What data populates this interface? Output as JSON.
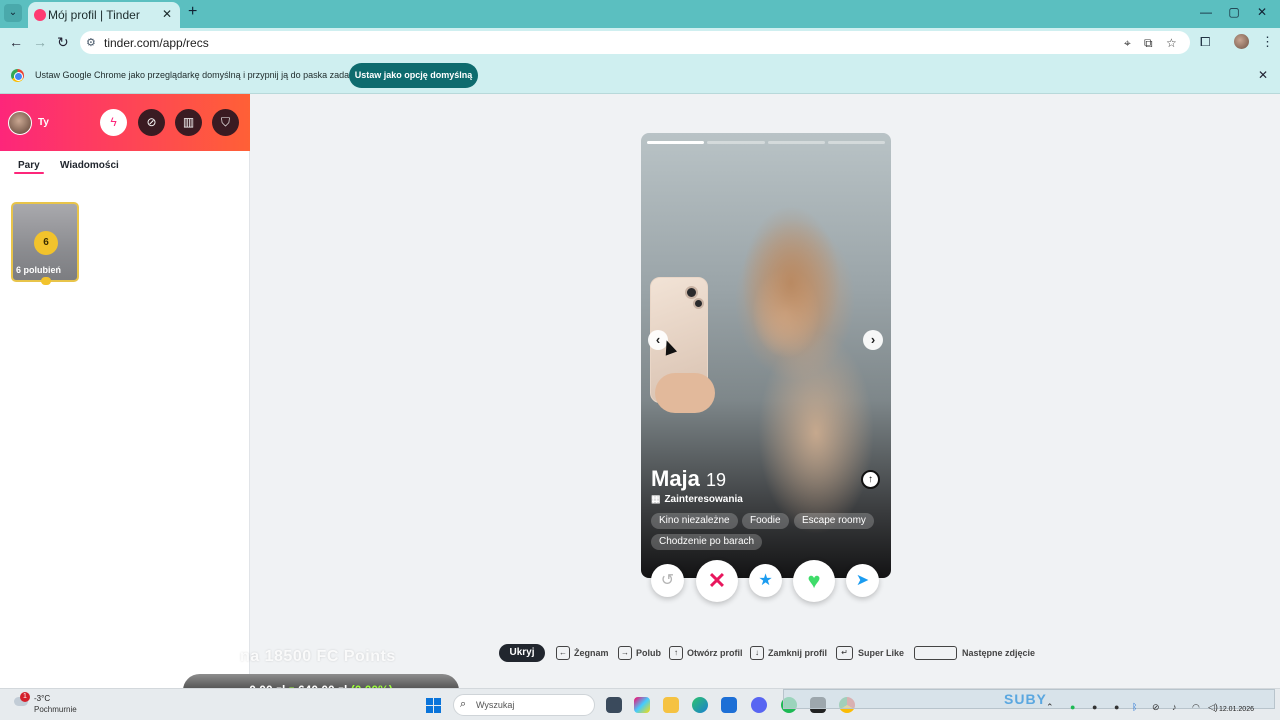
{
  "browser": {
    "tab_title": "Mój profil | Tinder",
    "url": "tinder.com/app/recs",
    "infobar_message": "Ustaw Google Chrome jako przeglądarkę domyślną i przypnij ją do paska zadań",
    "infobar_button": "Ustaw jako opcję domyślną"
  },
  "sidebar": {
    "user_label": "Ty",
    "tabs": [
      "Pary",
      "Wiadomości"
    ],
    "likes_count": "6",
    "likes_label": "6 polubień"
  },
  "profile": {
    "name": "Maja",
    "age": "19",
    "interests_title": "Zainteresowania",
    "interests": [
      "Kino niezależne",
      "Foodie",
      "Escape roomy",
      "Chodzenie po barach"
    ],
    "photo_count": 4,
    "current_photo": 1
  },
  "shortcuts": {
    "hide": "Ukryj",
    "items": [
      {
        "key": "←",
        "label": "Żegnam"
      },
      {
        "key": "→",
        "label": "Polub"
      },
      {
        "key": "↑",
        "label": "Otwórz profil"
      },
      {
        "key": "↓",
        "label": "Zamknij profil"
      },
      {
        "key": "↵",
        "label": "Super Like"
      },
      {
        "key": "",
        "label": "Następne zdjęcie"
      }
    ]
  },
  "overlay": {
    "fc_text": "na 18500 FC Points",
    "money_from": "0,00 zł",
    "money_sep": "z",
    "money_to": "640,00 zł",
    "money_pct": "(0.00%)"
  },
  "taskbar": {
    "temperature": "-3°C",
    "condition": "Pochmurnie",
    "weather_alert": "1",
    "search_placeholder": "Wyszukaj",
    "tray_text": "SUBY",
    "clock_date": "12.01.2026"
  },
  "colors": {
    "tinder_gradient_start": "#fd267a",
    "tinder_gradient_end": "#ff6036",
    "chrome_teal": "#5bbfc0",
    "infobar_button": "#0e6b6e",
    "nope": "#e8175d",
    "super_like": "#1b9cf0",
    "like": "#3fdc6a",
    "boost": "#1b9cf0"
  }
}
